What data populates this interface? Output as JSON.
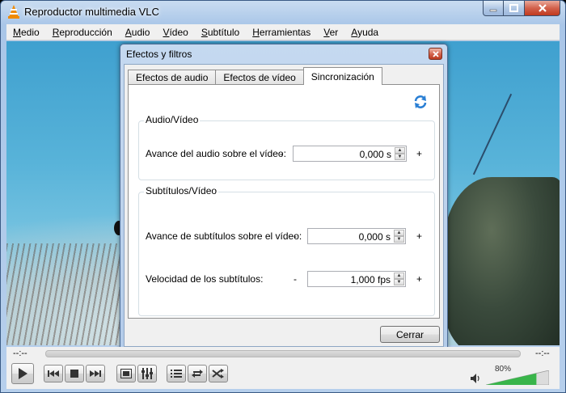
{
  "window": {
    "title": "Reproductor multimedia VLC"
  },
  "menu": [
    "Medio",
    "Reproducción",
    "Audio",
    "Vídeo",
    "Subtítulo",
    "Herramientas",
    "Ver",
    "Ayuda"
  ],
  "menu_mnemonics": [
    "M",
    "R",
    "A",
    "V",
    "S",
    "H",
    "V",
    "A"
  ],
  "dialog": {
    "title": "Efectos y filtros",
    "tabs": [
      "Efectos de audio",
      "Efectos de vídeo",
      "Sincronización"
    ],
    "active_tab": 2,
    "group_av": {
      "legend": "Audio/Vídeo",
      "label": "Avance del audio sobre el vídeo:",
      "minus": "-",
      "plus": "+",
      "value": "0,000 s"
    },
    "group_sub": {
      "legend": "Subtítulos/Vídeo",
      "advance_label": "Avance de subtítulos sobre el vídeo:",
      "advance_value": "0,000 s",
      "speed_label": "Velocidad de los subtítulos:",
      "speed_value": "1,000 fps",
      "minus": "-",
      "plus": "+"
    },
    "close_label": "Cerrar"
  },
  "player": {
    "time_elapsed": "--:--",
    "time_total": "--:--",
    "volume_label": "80%",
    "volume_level": 0.8
  },
  "colors": {
    "accent": "#3fa0cf",
    "volume_green": "#39b54a"
  }
}
